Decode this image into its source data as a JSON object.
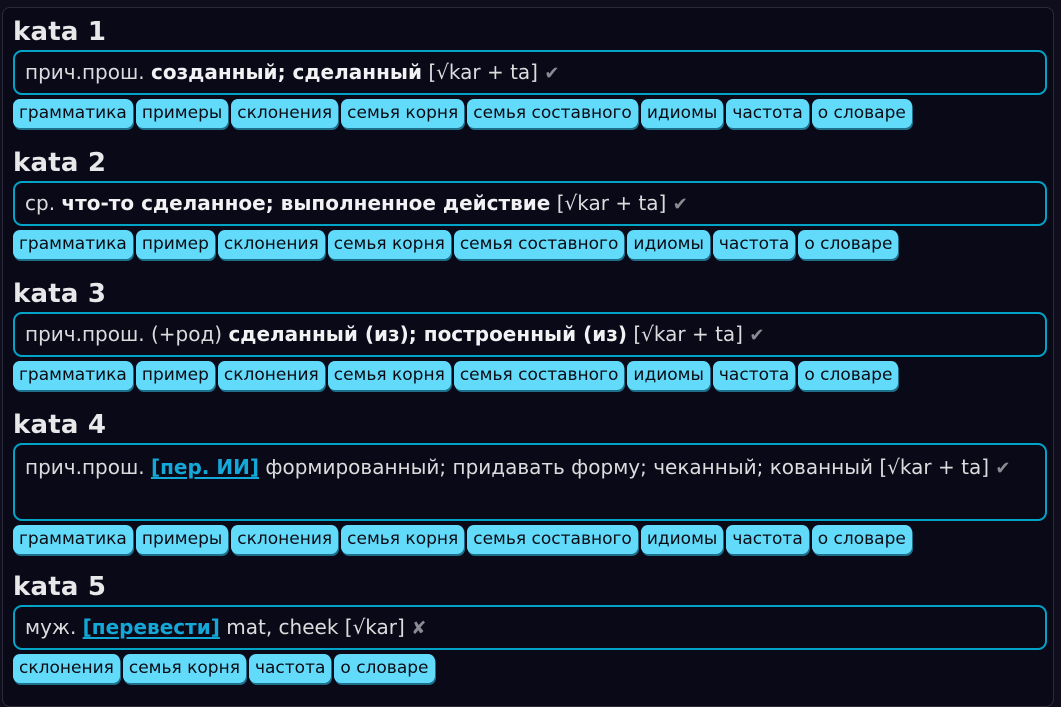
{
  "entries": [
    {
      "headword": "kata 1",
      "pos": "прич.прош. ",
      "meaning": "созданный; сделанный",
      "link": "",
      "tail": " [√kar + ta] ",
      "mark": "✔",
      "buttons": [
        "грамматика",
        "примеры",
        "склонения",
        "семья корня",
        "семья составного",
        "идиомы",
        "частота",
        "о словаре"
      ]
    },
    {
      "headword": "kata 2",
      "pos": "ср. ",
      "meaning": "что-то сделанное; выполненное действие",
      "link": "",
      "tail": " [√kar + ta] ",
      "mark": "✔",
      "buttons": [
        "грамматика",
        "пример",
        "склонения",
        "семья корня",
        "семья составного",
        "идиомы",
        "частота",
        "о словаре"
      ]
    },
    {
      "headword": "kata 3",
      "pos": "прич.прош. (+род) ",
      "meaning": "сделанный (из); построенный (из)",
      "link": "",
      "tail": " [√kar + ta] ",
      "mark": "✔",
      "buttons": [
        "грамматика",
        "пример",
        "склонения",
        "семья корня",
        "семья составного",
        "идиомы",
        "частота",
        "о словаре"
      ]
    },
    {
      "headword": "kata 4",
      "pos": "прич.прош. ",
      "meaning": "",
      "link": "[пер. ИИ]",
      "tail": " формированный; придавать форму; чеканный; кованный [√kar + ta] ",
      "mark": "✔",
      "buttons": [
        "грамматика",
        "примеры",
        "склонения",
        "семья корня",
        "семья составного",
        "идиомы",
        "частота",
        "о словаре"
      ]
    },
    {
      "headword": "kata 5",
      "pos": "муж. ",
      "meaning": "",
      "link": "[перевести]",
      "tail": " mat, cheek [√kar] ",
      "mark": "✘",
      "buttons": [
        "склонения",
        "семья корня",
        "частота",
        "о словаре"
      ]
    }
  ],
  "colors": {
    "background": "#0a0918",
    "box_border": "#01a4c6",
    "button_bg": "#62dbfb",
    "link": "#14a8d8"
  }
}
